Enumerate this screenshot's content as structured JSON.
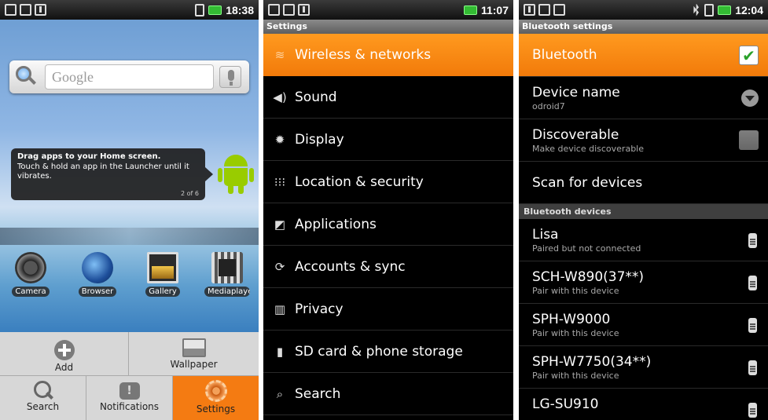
{
  "home": {
    "status_time": "18:38",
    "search_placeholder": "Google",
    "tip_title": "Drag apps to your Home screen.",
    "tip_body": "Touch & hold an app in the Launcher until it vibrates.",
    "tip_page": "2 of 6",
    "apps": [
      "Camera",
      "Browser",
      "Gallery",
      "Mediaplaye"
    ],
    "launcher": {
      "add": "Add",
      "wallpaper": "Wallpaper",
      "search": "Search",
      "notifications": "Notifications",
      "settings": "Settings"
    },
    "accent": "#f47b12"
  },
  "settings": {
    "status_time": "11:07",
    "title": "Settings",
    "items": [
      {
        "label": "Wireless & networks",
        "icon": "wifi-icon"
      },
      {
        "label": "Sound",
        "icon": "speaker-icon"
      },
      {
        "label": "Display",
        "icon": "brightness-icon"
      },
      {
        "label": "Location & security",
        "icon": "grid-icon"
      },
      {
        "label": "Applications",
        "icon": "applications-icon"
      },
      {
        "label": "Accounts & sync",
        "icon": "sync-icon"
      },
      {
        "label": "Privacy",
        "icon": "privacy-icon"
      },
      {
        "label": "SD card & phone storage",
        "icon": "sdcard-icon"
      },
      {
        "label": "Search",
        "icon": "search-icon"
      }
    ]
  },
  "bluetooth": {
    "status_time": "12:04",
    "title": "Bluetooth settings",
    "bluetooth_label": "Bluetooth",
    "device_name_label": "Device name",
    "device_name_value": "odroid7",
    "discoverable_label": "Discoverable",
    "discoverable_sub": "Make device discoverable",
    "scan_label": "Scan for devices",
    "devices_header": "Bluetooth devices",
    "devices": [
      {
        "name": "Lisa",
        "status": "Paired but not connected"
      },
      {
        "name": "SCH-W890(37**)",
        "status": "Pair with this device"
      },
      {
        "name": "SPH-W9000",
        "status": "Pair with this device"
      },
      {
        "name": "SPH-W7750(34**)",
        "status": "Pair with this device"
      },
      {
        "name": "LG-SU910",
        "status": ""
      }
    ]
  }
}
